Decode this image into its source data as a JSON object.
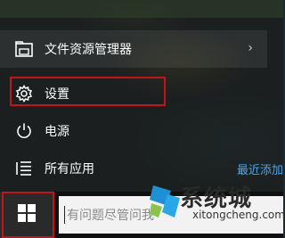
{
  "start_menu": {
    "items": [
      {
        "label": "文件资源管理器",
        "icon": "file-explorer-icon",
        "has_arrow": true
      },
      {
        "label": "设置",
        "icon": "gear-icon"
      },
      {
        "label": "电源",
        "icon": "power-icon"
      },
      {
        "label": "所有应用",
        "icon": "list-icon"
      }
    ],
    "recent_label": "最近添加",
    "arrow": "›"
  },
  "taskbar": {
    "search_placeholder": "有问题尽管问我"
  },
  "watermark": {
    "name": "系统城",
    "url": "xitongcheng.com"
  },
  "colors": {
    "highlight": "#c4141b",
    "accent": "#4ea6ea"
  }
}
